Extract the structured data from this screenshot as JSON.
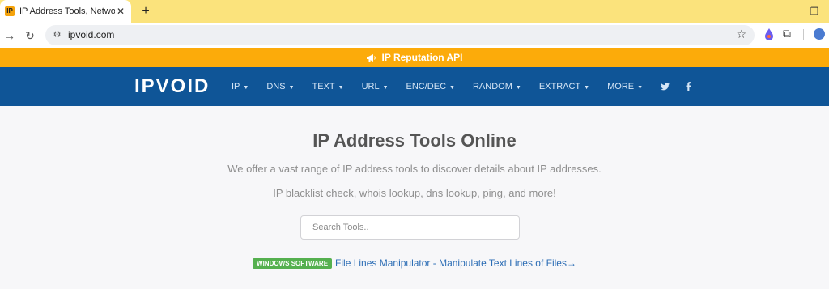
{
  "browser": {
    "tab": {
      "favicon": "IP",
      "title": "IP Address Tools, Network Tools",
      "close": "✕"
    },
    "new_tab": "+",
    "window": {
      "minimize": "–",
      "maximize": "❐"
    },
    "address": {
      "url": "ipvoid.com"
    }
  },
  "banner": {
    "icon": "megaphone-icon",
    "text": "IP Reputation API"
  },
  "navbar": {
    "logo": "IPVOID",
    "items": [
      {
        "label": "IP"
      },
      {
        "label": "DNS"
      },
      {
        "label": "TEXT"
      },
      {
        "label": "URL"
      },
      {
        "label": "ENC/DEC"
      },
      {
        "label": "RANDOM"
      },
      {
        "label": "EXTRACT"
      },
      {
        "label": "MORE"
      }
    ],
    "social": [
      "twitter-icon",
      "facebook-icon"
    ]
  },
  "main": {
    "title": "IP Address Tools Online",
    "subtitle1": "We offer a vast range of IP address tools to discover details about IP addresses.",
    "subtitle2": "IP blacklist check, whois lookup, dns lookup, ping, and more!",
    "search_placeholder": "Search Tools..",
    "promo_badge": "WINDOWS SOFTWARE",
    "promo_link": "File Lines Manipulator - Manipulate Text Lines of Files→"
  },
  "colors": {
    "tabstrip": "#fbe37c",
    "banner": "#fcab0a",
    "navbar": "#0f5597",
    "badge": "#55b04f",
    "link": "#2c6db5"
  }
}
